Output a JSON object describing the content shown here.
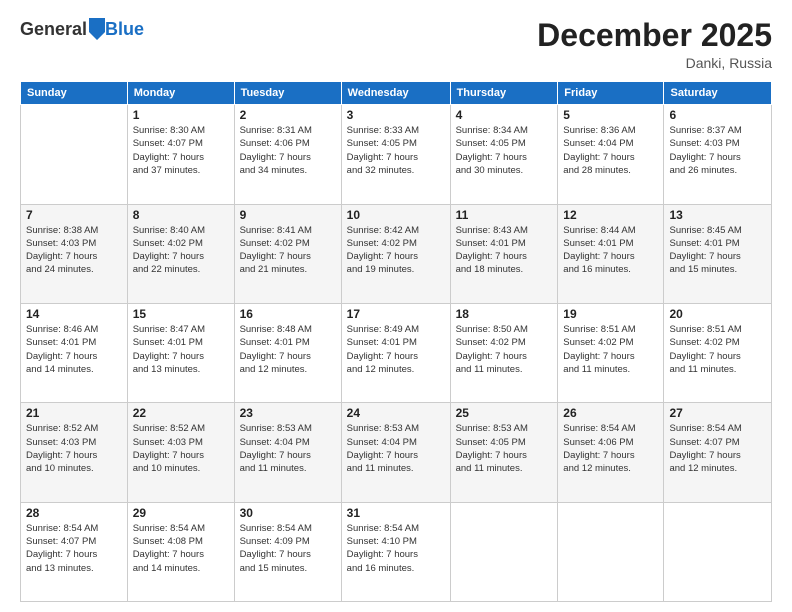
{
  "header": {
    "logo_general": "General",
    "logo_blue": "Blue",
    "month_title": "December 2025",
    "location": "Danki, Russia"
  },
  "weekdays": [
    "Sunday",
    "Monday",
    "Tuesday",
    "Wednesday",
    "Thursday",
    "Friday",
    "Saturday"
  ],
  "weeks": [
    [
      {
        "day": "",
        "info": ""
      },
      {
        "day": "1",
        "info": "Sunrise: 8:30 AM\nSunset: 4:07 PM\nDaylight: 7 hours\nand 37 minutes."
      },
      {
        "day": "2",
        "info": "Sunrise: 8:31 AM\nSunset: 4:06 PM\nDaylight: 7 hours\nand 34 minutes."
      },
      {
        "day": "3",
        "info": "Sunrise: 8:33 AM\nSunset: 4:05 PM\nDaylight: 7 hours\nand 32 minutes."
      },
      {
        "day": "4",
        "info": "Sunrise: 8:34 AM\nSunset: 4:05 PM\nDaylight: 7 hours\nand 30 minutes."
      },
      {
        "day": "5",
        "info": "Sunrise: 8:36 AM\nSunset: 4:04 PM\nDaylight: 7 hours\nand 28 minutes."
      },
      {
        "day": "6",
        "info": "Sunrise: 8:37 AM\nSunset: 4:03 PM\nDaylight: 7 hours\nand 26 minutes."
      }
    ],
    [
      {
        "day": "7",
        "info": "Sunrise: 8:38 AM\nSunset: 4:03 PM\nDaylight: 7 hours\nand 24 minutes."
      },
      {
        "day": "8",
        "info": "Sunrise: 8:40 AM\nSunset: 4:02 PM\nDaylight: 7 hours\nand 22 minutes."
      },
      {
        "day": "9",
        "info": "Sunrise: 8:41 AM\nSunset: 4:02 PM\nDaylight: 7 hours\nand 21 minutes."
      },
      {
        "day": "10",
        "info": "Sunrise: 8:42 AM\nSunset: 4:02 PM\nDaylight: 7 hours\nand 19 minutes."
      },
      {
        "day": "11",
        "info": "Sunrise: 8:43 AM\nSunset: 4:01 PM\nDaylight: 7 hours\nand 18 minutes."
      },
      {
        "day": "12",
        "info": "Sunrise: 8:44 AM\nSunset: 4:01 PM\nDaylight: 7 hours\nand 16 minutes."
      },
      {
        "day": "13",
        "info": "Sunrise: 8:45 AM\nSunset: 4:01 PM\nDaylight: 7 hours\nand 15 minutes."
      }
    ],
    [
      {
        "day": "14",
        "info": "Sunrise: 8:46 AM\nSunset: 4:01 PM\nDaylight: 7 hours\nand 14 minutes."
      },
      {
        "day": "15",
        "info": "Sunrise: 8:47 AM\nSunset: 4:01 PM\nDaylight: 7 hours\nand 13 minutes."
      },
      {
        "day": "16",
        "info": "Sunrise: 8:48 AM\nSunset: 4:01 PM\nDaylight: 7 hours\nand 12 minutes."
      },
      {
        "day": "17",
        "info": "Sunrise: 8:49 AM\nSunset: 4:01 PM\nDaylight: 7 hours\nand 12 minutes."
      },
      {
        "day": "18",
        "info": "Sunrise: 8:50 AM\nSunset: 4:02 PM\nDaylight: 7 hours\nand 11 minutes."
      },
      {
        "day": "19",
        "info": "Sunrise: 8:51 AM\nSunset: 4:02 PM\nDaylight: 7 hours\nand 11 minutes."
      },
      {
        "day": "20",
        "info": "Sunrise: 8:51 AM\nSunset: 4:02 PM\nDaylight: 7 hours\nand 11 minutes."
      }
    ],
    [
      {
        "day": "21",
        "info": "Sunrise: 8:52 AM\nSunset: 4:03 PM\nDaylight: 7 hours\nand 10 minutes."
      },
      {
        "day": "22",
        "info": "Sunrise: 8:52 AM\nSunset: 4:03 PM\nDaylight: 7 hours\nand 10 minutes."
      },
      {
        "day": "23",
        "info": "Sunrise: 8:53 AM\nSunset: 4:04 PM\nDaylight: 7 hours\nand 11 minutes."
      },
      {
        "day": "24",
        "info": "Sunrise: 8:53 AM\nSunset: 4:04 PM\nDaylight: 7 hours\nand 11 minutes."
      },
      {
        "day": "25",
        "info": "Sunrise: 8:53 AM\nSunset: 4:05 PM\nDaylight: 7 hours\nand 11 minutes."
      },
      {
        "day": "26",
        "info": "Sunrise: 8:54 AM\nSunset: 4:06 PM\nDaylight: 7 hours\nand 12 minutes."
      },
      {
        "day": "27",
        "info": "Sunrise: 8:54 AM\nSunset: 4:07 PM\nDaylight: 7 hours\nand 12 minutes."
      }
    ],
    [
      {
        "day": "28",
        "info": "Sunrise: 8:54 AM\nSunset: 4:07 PM\nDaylight: 7 hours\nand 13 minutes."
      },
      {
        "day": "29",
        "info": "Sunrise: 8:54 AM\nSunset: 4:08 PM\nDaylight: 7 hours\nand 14 minutes."
      },
      {
        "day": "30",
        "info": "Sunrise: 8:54 AM\nSunset: 4:09 PM\nDaylight: 7 hours\nand 15 minutes."
      },
      {
        "day": "31",
        "info": "Sunrise: 8:54 AM\nSunset: 4:10 PM\nDaylight: 7 hours\nand 16 minutes."
      },
      {
        "day": "",
        "info": ""
      },
      {
        "day": "",
        "info": ""
      },
      {
        "day": "",
        "info": ""
      }
    ]
  ]
}
